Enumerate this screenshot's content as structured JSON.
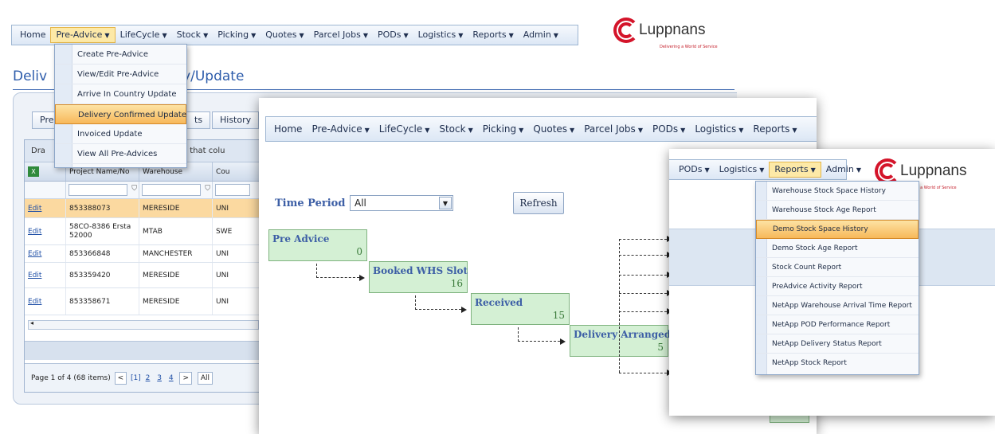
{
  "w1": {
    "menu": [
      {
        "label": "Home",
        "caret": false
      },
      {
        "label": "Pre-Advice",
        "caret": true
      },
      {
        "label": "LifeCycle",
        "caret": true
      },
      {
        "label": "Stock",
        "caret": true
      },
      {
        "label": "Picking",
        "caret": true
      },
      {
        "label": "Quotes",
        "caret": true
      },
      {
        "label": "Parcel Jobs",
        "caret": true
      },
      {
        "label": "PODs",
        "caret": true
      },
      {
        "label": "Logistics",
        "caret": true
      },
      {
        "label": "Reports",
        "caret": true
      },
      {
        "label": "Admin",
        "caret": true
      }
    ],
    "dropdown": [
      "Create Pre-Advice",
      "View/Edit Pre-Advice",
      "Arrive In Country Update",
      "Delivery Confirmed Update",
      "Invoiced Update",
      "View All Pre-Advices"
    ],
    "title_left": "Deliv",
    "title_right": "y/Update",
    "tabs": {
      "t1": "Pre",
      "t2": "ts",
      "t3": "History"
    },
    "group_text_left": "Dra",
    "group_text_right": "up by that colu",
    "columns": {
      "c2": "Project Name/No",
      "c3": "Warehouse",
      "c4": "Cou"
    },
    "rows": [
      {
        "edit": "Edit",
        "project": "853388073",
        "warehouse": "MERESIDE",
        "country": "UNI"
      },
      {
        "edit": "Edit",
        "project": "58CO-8386 Ersta 52000",
        "warehouse": "MTAB",
        "country": "SWE"
      },
      {
        "edit": "Edit",
        "project": "853366848",
        "warehouse": "MANCHESTER",
        "country": "UNI"
      },
      {
        "edit": "Edit",
        "project": "853359420",
        "warehouse": "MERESIDE",
        "country": "UNI"
      },
      {
        "edit": "Edit",
        "project": "853358671",
        "warehouse": "MERESIDE",
        "country": "UNI"
      }
    ],
    "pager": {
      "text": "Page 1 of 4 (68 items)",
      "current": "[1]",
      "pages": [
        "2",
        "3",
        "4"
      ],
      "all": "All"
    }
  },
  "w2": {
    "menu": [
      {
        "label": "Home",
        "caret": false
      },
      {
        "label": "Pre-Advice",
        "caret": true
      },
      {
        "label": "LifeCycle",
        "caret": true
      },
      {
        "label": "Stock",
        "caret": true
      },
      {
        "label": "Picking",
        "caret": true
      },
      {
        "label": "Quotes",
        "caret": true
      },
      {
        "label": "Parcel Jobs",
        "caret": true
      },
      {
        "label": "PODs",
        "caret": true
      },
      {
        "label": "Logistics",
        "caret": true
      },
      {
        "label": "Reports",
        "caret": true
      }
    ],
    "time_period_label": "Time Period",
    "time_period_value": "All",
    "refresh": "Refresh",
    "stages": [
      {
        "label": "Pre Advice",
        "count": "0"
      },
      {
        "label": "Booked WHS Slot",
        "count": "16"
      },
      {
        "label": "Received",
        "count": "15"
      },
      {
        "label": "Delivery Arranged",
        "count": "5"
      }
    ]
  },
  "w3": {
    "menu": [
      {
        "label": "PODs",
        "caret": true
      },
      {
        "label": "Logistics",
        "caret": true
      },
      {
        "label": "Reports",
        "caret": true
      },
      {
        "label": "Admin",
        "caret": true
      }
    ],
    "dropdown": [
      "Warehouse Stock Space History",
      "Warehouse Stock Age Report",
      "Demo Stock Space History",
      "Demo Stock Age Report",
      "Stock Count Report",
      "PreAdvice Activity Report",
      "NetApp Warehouse Arrival Time Report",
      "NetApp POD Performance Report",
      "NetApp Delivery Status Report",
      "NetApp Stock Report"
    ]
  },
  "logo": {
    "name": "Luppnans",
    "tagline": "Delivering a World of Service"
  },
  "colors": {
    "accent": "#2d5cab",
    "highlight": "#f7b85a",
    "stage_fill": "#d4f0d4",
    "brand_red": "#d4142a"
  }
}
